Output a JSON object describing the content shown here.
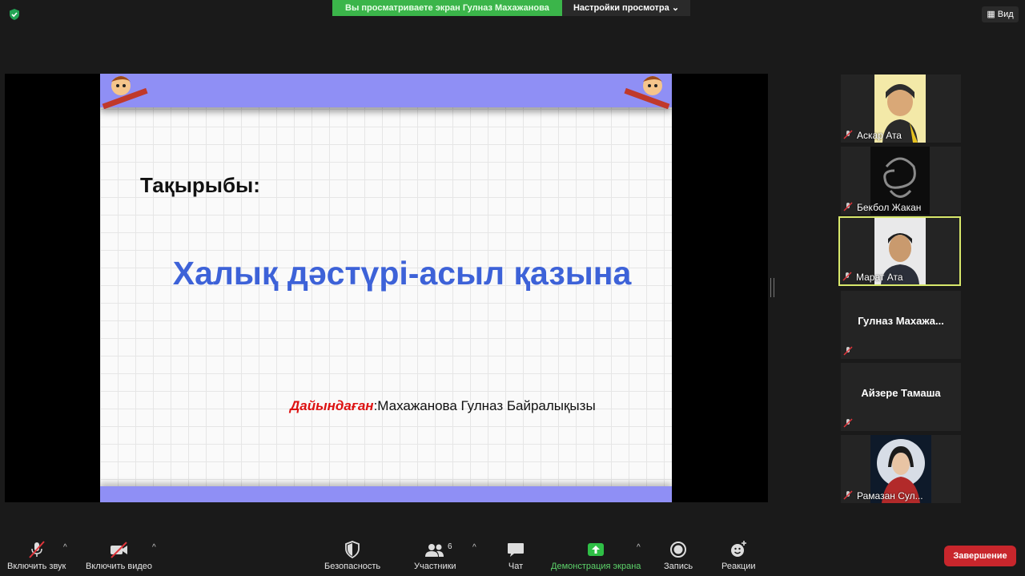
{
  "banner": {
    "text": "Вы просматриваете экран Гулназ  Махажанова",
    "view_options": "Настройки просмотра"
  },
  "view_button": "Вид",
  "slide": {
    "heading": "Тақырыбы:",
    "title": "Халық дәстүрі-асыл қазына",
    "author_label": "Дайындаған",
    "author_name": ":Махажанова Гулназ Байралықызы"
  },
  "participants": [
    {
      "name": "Аскар  Ата",
      "muted": true
    },
    {
      "name": "Бекбол Жакан",
      "muted": true
    },
    {
      "name": "Марат Ата",
      "muted": true,
      "active": true
    },
    {
      "name": "Гулназ  Махажа...",
      "muted": true,
      "video": false
    },
    {
      "name": "Айзере Тамаша",
      "muted": true,
      "video": false
    },
    {
      "name": "Рамазан Сул...",
      "muted": true
    }
  ],
  "toolbar": {
    "audio": "Включить звук",
    "video": "Включить видео",
    "security": "Безопасность",
    "participants": "Участники",
    "participants_count": "6",
    "chat": "Чат",
    "share": "Демонстрация экрана",
    "record": "Запись",
    "reactions": "Реакции",
    "end": "Завершение"
  },
  "colors": {
    "banner_green": "#3bb54a",
    "share_green": "#5dd46b",
    "end_red": "#c8262c",
    "active_border": "#d8e86b",
    "slide_title_blue": "#3d62d8"
  }
}
